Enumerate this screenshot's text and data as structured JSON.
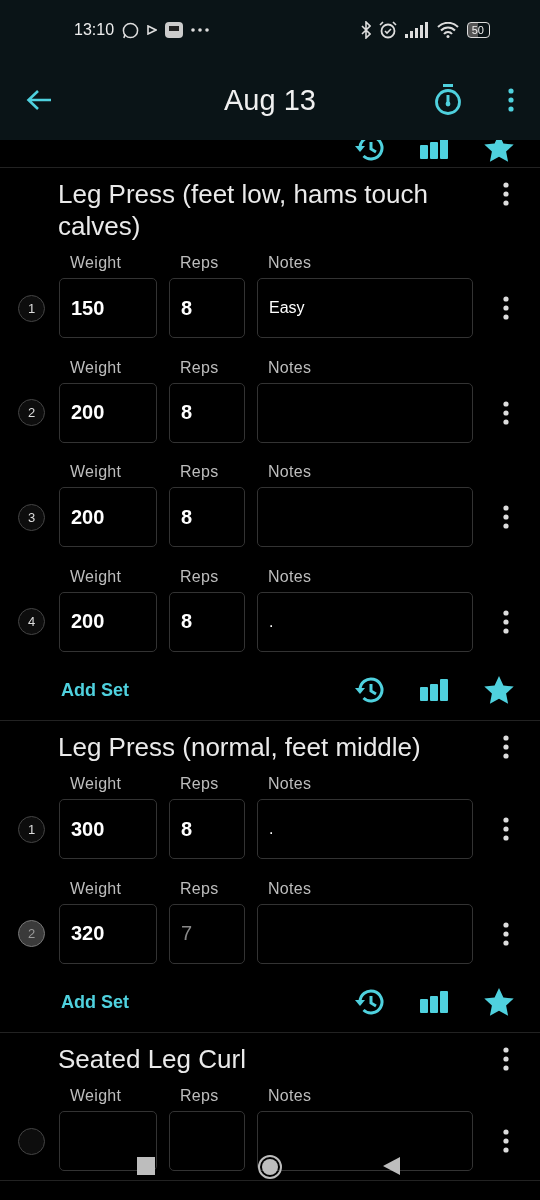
{
  "status_bar": {
    "time": "13:10",
    "battery": "50"
  },
  "app_bar": {
    "title": "Aug 13"
  },
  "exercises": [
    {
      "name": "Leg Press (feet low, hams touch calves)",
      "add_set": "Add Set",
      "sets": [
        {
          "number": "1",
          "current": false,
          "labels": [
            "Weight",
            "Reps",
            "Notes"
          ],
          "weight": "150",
          "reps": "8",
          "notes": "Easy"
        },
        {
          "number": "2",
          "current": false,
          "labels": [
            "Weight",
            "Reps",
            "Notes"
          ],
          "weight": "200",
          "reps": "8"
        },
        {
          "number": "3",
          "current": false,
          "labels": [
            "Weight",
            "Reps",
            "Notes"
          ],
          "weight": "200",
          "reps": "8"
        },
        {
          "number": "4",
          "current": false,
          "labels": [
            "Weight",
            "Reps",
            "Notes"
          ],
          "weight": "200",
          "reps": "8",
          "notes": "."
        }
      ]
    },
    {
      "name": "Leg Press (normal, feet middle)",
      "add_set": "Add Set",
      "sets": [
        {
          "number": "1",
          "current": false,
          "labels": [
            "Weight",
            "Reps",
            "Notes"
          ],
          "weight": "300",
          "reps": "8",
          "notes": "."
        },
        {
          "number": "2",
          "current": true,
          "labels": [
            "Weight",
            "Reps",
            "Notes"
          ],
          "weight": "320",
          "reps_placeholder": "7"
        }
      ]
    },
    {
      "name": "Seated Leg Curl",
      "sets": [
        {
          "current": false,
          "labels": [
            "Weight",
            "Reps",
            "Notes"
          ]
        }
      ]
    }
  ]
}
